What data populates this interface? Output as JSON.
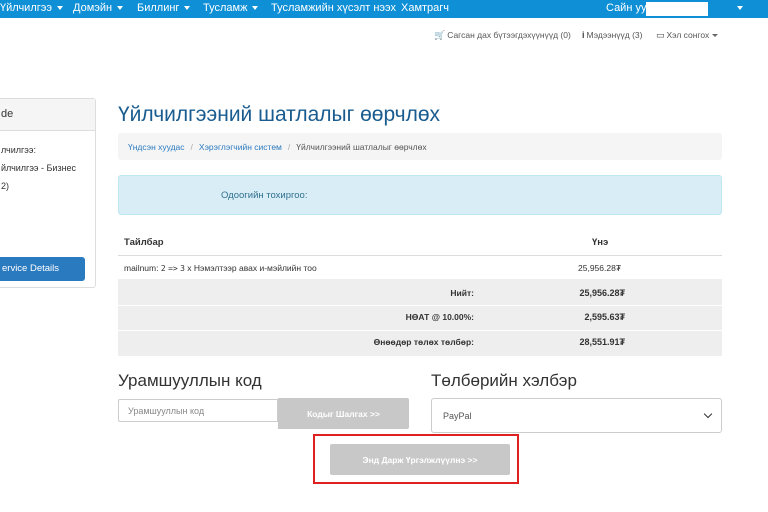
{
  "topnav": {
    "items": [
      "Үйлчилгээ",
      "Домэйн",
      "Биллинг",
      "Тусламж",
      "Тусламжийн хүсэлт нээх",
      "Хамтрагч"
    ],
    "greeting": "Сайн уу,"
  },
  "subnav": {
    "cart": "Сагсан дах бүтээгдэхүүнүүд (0)",
    "notifications": "Мэдээнүүд (3)",
    "language": "Хэл сонгох"
  },
  "sidebar": {
    "header": "de",
    "lines": [
      "лчилгээ:",
      "йлчилгээ - Бизнес",
      "2)"
    ],
    "button": "ervice Details"
  },
  "page": {
    "title": "Үйлчилгээний шатлалыг өөрчлөх",
    "breadcrumb": [
      "Үндсэн хуудас",
      "Хэрэглэгчийн систем",
      "Үйлчилгээний шатлалыг өөрчлөх"
    ],
    "alert": "Одоогийн тохиргоо:"
  },
  "table": {
    "col_description": "Тайлбар",
    "col_price": "Үнэ",
    "row": {
      "prefix": "mailnum:",
      "from": "2",
      "arrow": "=>",
      "to": "3",
      "suffix": "x Нэмэлтээр авах и-мэйлийн тоо",
      "price": "25,956.28₮"
    },
    "totals": [
      {
        "label": "Нийт:",
        "value": "25,956.28₮"
      },
      {
        "label": "НӨАТ @ 10.00%:",
        "value": "2,595.63₮"
      },
      {
        "label": "Өнөөдөр төлөх төлбөр:",
        "value": "28,551.91₮"
      }
    ]
  },
  "promo": {
    "title": "Урамшууллын код",
    "placeholder": "Урамшууллын код",
    "button": "Кодыг Шалгах >>"
  },
  "payment": {
    "title": "Төлбөрийн хэлбэр",
    "selected": "PayPal"
  },
  "checkout": {
    "button": "Энд Дарж Үргэлжлүүлнэ >>"
  }
}
